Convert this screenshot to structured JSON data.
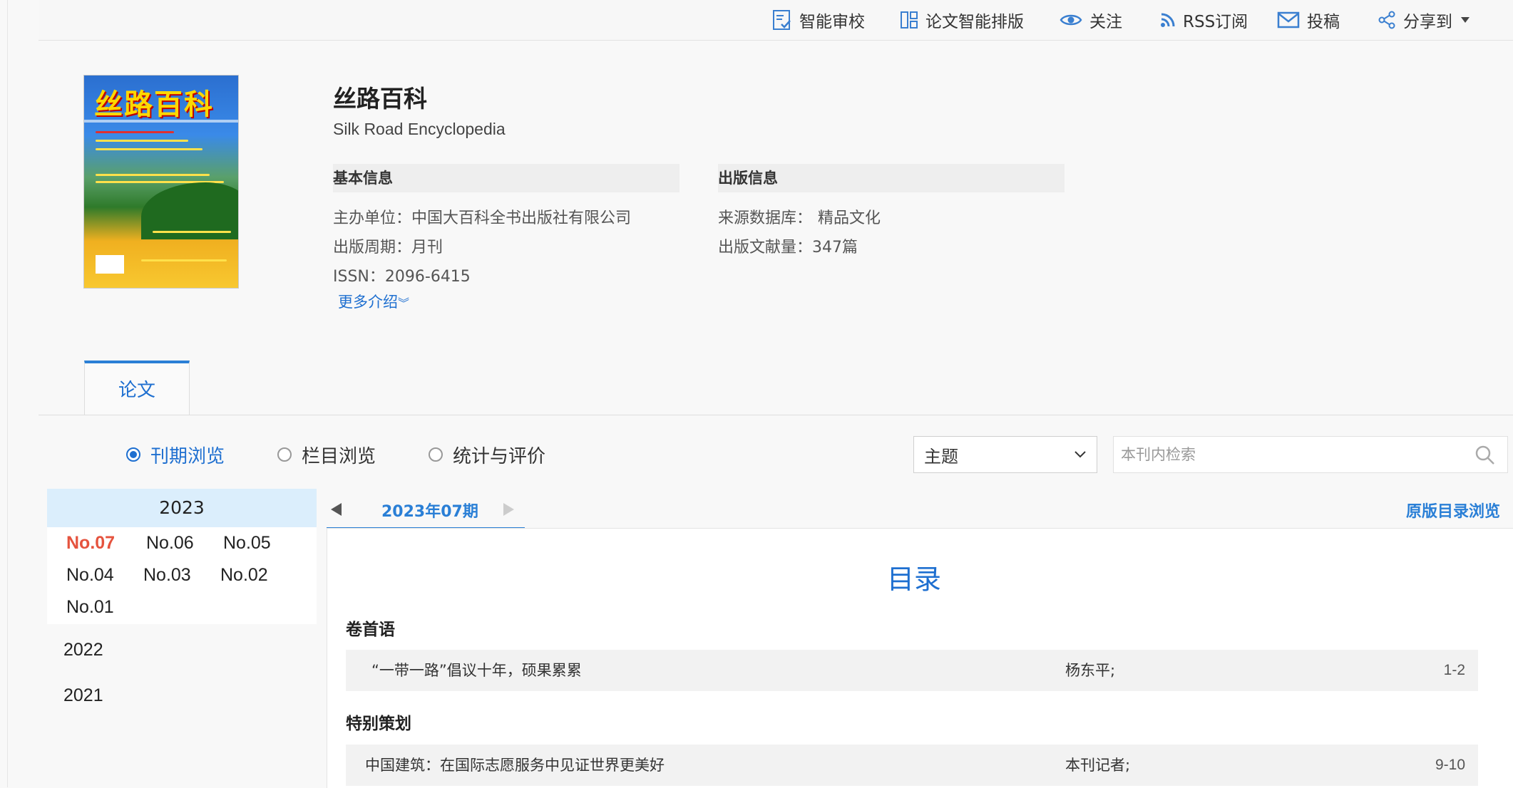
{
  "toolbar": {
    "items": [
      {
        "label": "智能审校",
        "icon": "check-doc-icon"
      },
      {
        "label": "论文智能排版",
        "icon": "layout-icon"
      },
      {
        "label": "关注",
        "icon": "eye-icon"
      },
      {
        "label": "RSS订阅",
        "icon": "rss-icon"
      },
      {
        "label": "投稿",
        "icon": "mail-icon"
      },
      {
        "label": "分享到",
        "icon": "share-icon"
      }
    ]
  },
  "journal": {
    "title": "丝路百科",
    "subtitle": "Silk Road Encyclopedia",
    "cover_title": "丝路百科",
    "basic_info": {
      "heading": "基本信息",
      "sponsor_label": "主办单位：",
      "sponsor_value": "中国大百科全书出版社有限公司",
      "period_label": "出版周期：",
      "period_value": "月刊",
      "issn_label": "ISSN：",
      "issn_value": "2096-6415",
      "more": "更多介绍"
    },
    "pub_info": {
      "heading": "出版信息",
      "source_label": "来源数据库：",
      "source_value": "精品文化",
      "count_label": "出版文献量：",
      "count_value": "347篇"
    }
  },
  "tabs": [
    {
      "label": "论文"
    }
  ],
  "browse": {
    "options": [
      {
        "label": "刊期浏览",
        "selected": true
      },
      {
        "label": "栏目浏览",
        "selected": false
      },
      {
        "label": "统计与评价",
        "selected": false
      }
    ],
    "filter_selected": "主题",
    "search_placeholder": "本刊内检索"
  },
  "years": {
    "current": "2023",
    "issues": [
      "No.07",
      "No.06",
      "No.05",
      "No.04",
      "No.03",
      "No.02",
      "No.01"
    ],
    "active_issue": "No.07",
    "others": [
      "2022",
      "2021"
    ]
  },
  "issue_nav": {
    "label": "2023年07期",
    "original_toc": "原版目录浏览"
  },
  "toc": {
    "title": "目录",
    "sections": [
      {
        "name": "卷首语",
        "articles": [
          {
            "title": "“一带一路”倡议十年，硕果累累",
            "author": "杨东平;",
            "pages": "1-2"
          }
        ]
      },
      {
        "name": "特别策划",
        "articles": [
          {
            "title": "中国建筑：在国际志愿服务中见证世界更美好",
            "author": "本刊记者;",
            "pages": "9-10"
          }
        ]
      }
    ]
  }
}
